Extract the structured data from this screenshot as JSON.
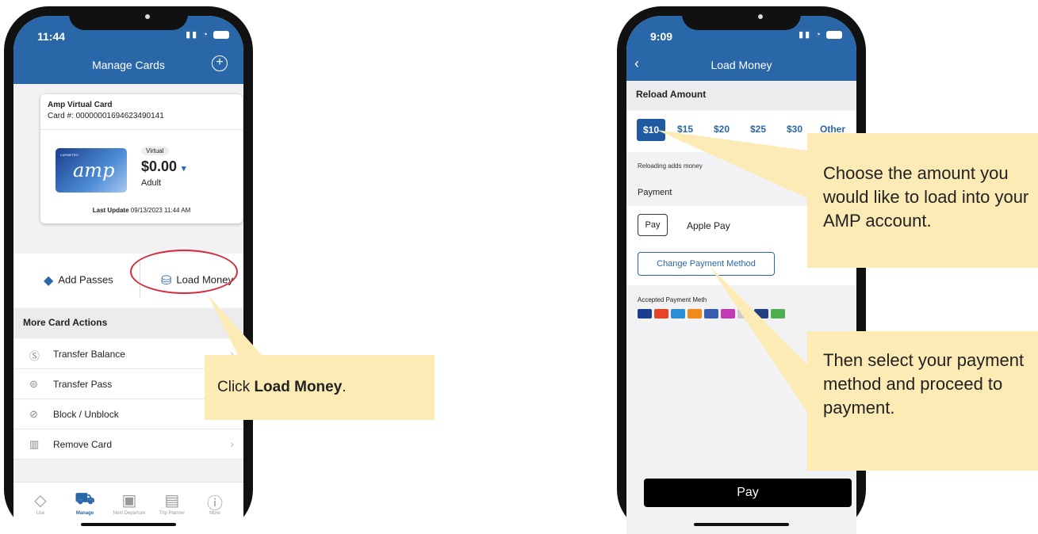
{
  "phone1": {
    "status_time": "11:44",
    "nav_title": "Manage Cards",
    "plus_label": "+",
    "card": {
      "name": "Amp Virtual Card",
      "number": "Card #: 00000001694623490141",
      "card_brand_small": "CAPMETRO",
      "card_logo": "amp",
      "badge": "Virtual",
      "balance": "$0.00",
      "fare_type": "Adult",
      "last_update_label": "Last Update",
      "last_update_value": "09/13/2023 11:44 AM"
    },
    "actions": {
      "add_passes": "Add Passes",
      "load_money": "Load Money"
    },
    "section_title": "More Card Actions",
    "list": [
      {
        "label": "Transfer Balance",
        "icon": "transfer-balance-icon"
      },
      {
        "label": "Transfer Pass",
        "icon": "transfer-pass-icon"
      },
      {
        "label": "Block / Unblock",
        "icon": "block-icon"
      },
      {
        "label": "Remove Card",
        "icon": "trash-icon"
      }
    ],
    "tabs": [
      {
        "label": "Use",
        "icon": "ticket-icon"
      },
      {
        "label": "Manage",
        "icon": "cart-icon"
      },
      {
        "label": "Next Departure",
        "icon": "bus-icon"
      },
      {
        "label": "Trip Planner",
        "icon": "map-icon"
      },
      {
        "label": "More",
        "icon": "info-icon"
      }
    ]
  },
  "phone2": {
    "status_time": "9:09",
    "nav_title": "Load Money",
    "section_title": "Reload Amount",
    "amounts": [
      "$10",
      "$15",
      "$20",
      "$25",
      "$30",
      "Other"
    ],
    "selected_amount": "$10",
    "reload_note": "Reloading adds money",
    "payment_label": "Payment",
    "payment_chip": "Pay",
    "payment_method": "Apple Pay",
    "change_button": "Change Payment Method",
    "accepted_label": "Accepted Payment Meth",
    "pay_button": "Pay"
  },
  "callouts": {
    "step1_prefix": "Click ",
    "step1_bold": "Load Money",
    "step1_suffix": ".",
    "step2": "Choose the amount you would like to load into your AMP account.",
    "step3": "Then select your payment method and proceed to payment."
  },
  "colors": {
    "brand_blue": "#2a67a8",
    "callout_yellow": "#fcebb5",
    "highlight_red": "#d62a3a"
  }
}
